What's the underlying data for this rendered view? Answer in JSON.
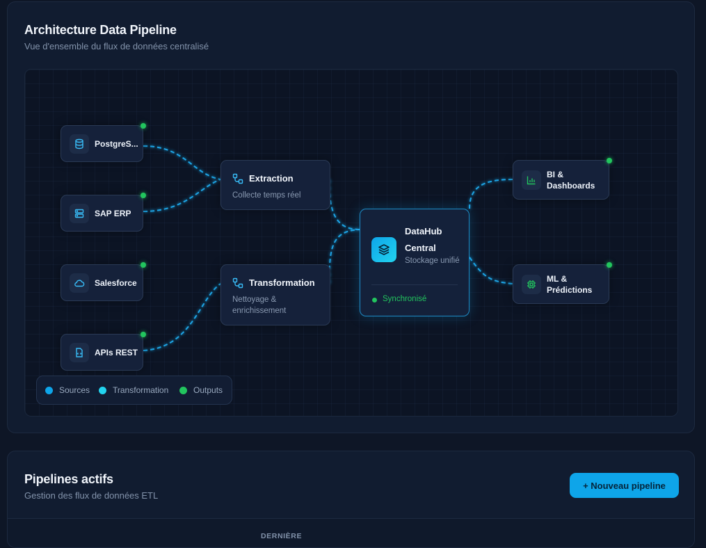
{
  "architecture": {
    "title": "Architecture Data Pipeline",
    "subtitle": "Vue d'ensemble du flux de données centralisé",
    "sources": [
      {
        "label": "PostgreSQL",
        "display": "PostgreS...",
        "icon": "database-icon"
      },
      {
        "label": "SAP ERP",
        "icon": "server-icon"
      },
      {
        "label": "Salesforce",
        "icon": "cloud-icon"
      },
      {
        "label": "APIs REST",
        "icon": "api-file-icon"
      }
    ],
    "stages": [
      {
        "title": "Extraction",
        "subtitle": "Collecte temps réel",
        "icon": "workflow-icon"
      },
      {
        "title": "Transformation",
        "subtitle": "Nettoyage & enrichissement",
        "icon": "workflow-icon"
      }
    ],
    "hub": {
      "title": "DataHub Central",
      "subtitle": "Stockage unifié",
      "status": "Synchronisé",
      "icon": "layers-icon"
    },
    "outputs": [
      {
        "label": "BI & Dashboards",
        "icon": "bar-chart-icon"
      },
      {
        "label": "ML & Prédictions",
        "icon": "cpu-icon"
      }
    ],
    "legend": [
      {
        "label": "Sources",
        "color": "#0ea5e9"
      },
      {
        "label": "Transformation",
        "color": "#22d3ee"
      },
      {
        "label": "Outputs",
        "color": "#22c55e"
      }
    ]
  },
  "pipelines": {
    "title": "Pipelines actifs",
    "subtitle": "Gestion des flux de données ETL",
    "new_button": "+ Nouveau pipeline",
    "table_header_partial": "DERNIÈRE"
  },
  "colors": {
    "accent": "#0ea5e9",
    "success": "#22c55e",
    "link": "#1ea5e6"
  }
}
